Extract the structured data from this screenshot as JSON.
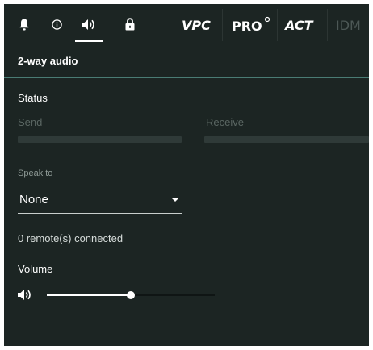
{
  "toolbar": {
    "icons": [
      "bell-icon",
      "info-icon",
      "speaker-icon",
      "lock-icon"
    ],
    "active_tab": "speaker-icon",
    "brands": [
      "VPC",
      "PRO",
      "ACT",
      "IDM"
    ]
  },
  "header": {
    "title": "2-way audio"
  },
  "status": {
    "title": "Status",
    "send_label": "Send",
    "receive_label": "Receive",
    "send_level": 0,
    "receive_level": 0
  },
  "speak_to": {
    "label": "Speak to",
    "value": "None"
  },
  "connection": {
    "text": "0 remote(s) connected"
  },
  "volume": {
    "title": "Volume",
    "icon": "speaker-icon",
    "level": 0.5
  },
  "colors": {
    "background": "#1c2523",
    "accent_divider": "#4a7c74",
    "meter": "#2f3a38",
    "text": "#ffffff"
  }
}
